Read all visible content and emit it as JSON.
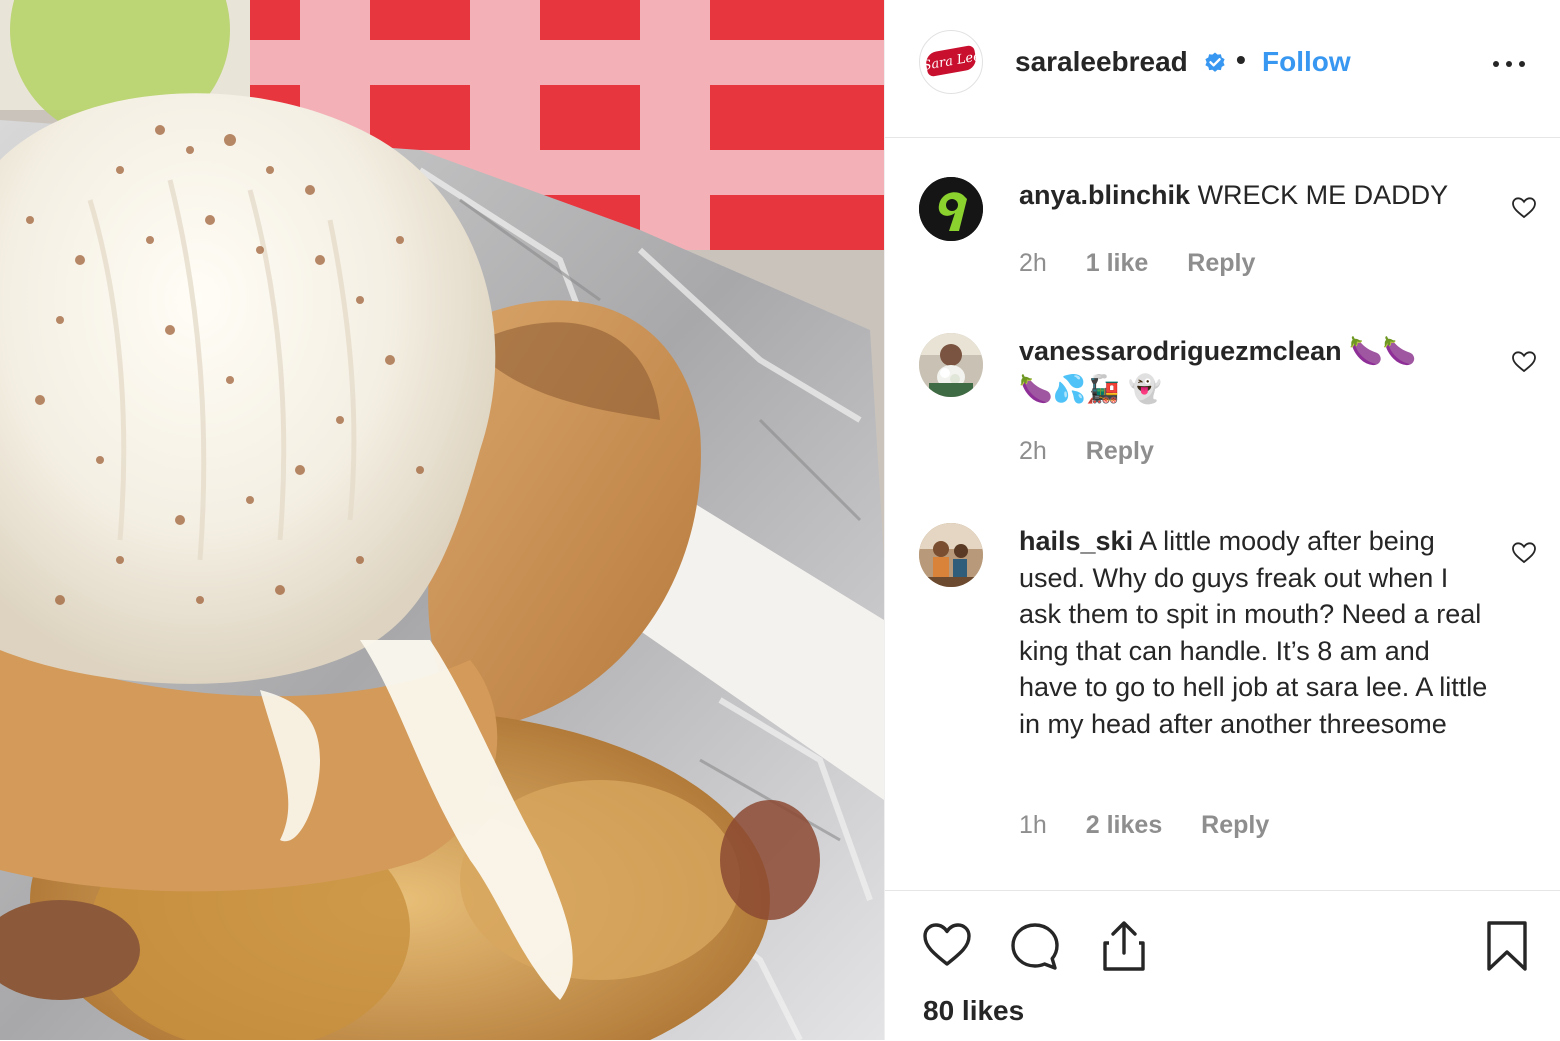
{
  "post": {
    "image_alt": "Ice cream on bread and baked apple in foil"
  },
  "header": {
    "avatar_text": "Sara Lee",
    "username": "saraleebread",
    "separator": "•",
    "follow_label": "Follow"
  },
  "comments": [
    {
      "username": "anya.blinchik",
      "text": "WRECK ME DADDY",
      "time": "2h",
      "likes": "1 like",
      "reply": "Reply"
    },
    {
      "username": "vanessarodriguezmclean",
      "text_line1": "🍆🍆",
      "text_line2": "🍆💦🚂 👻",
      "time": "2h",
      "reply": "Reply"
    },
    {
      "username": "hails_ski",
      "text": "A little moody after being used. Why do guys freak out when I ask them to spit in mouth? Need a real king that can handle. It’s 8 am and have to go to hell job at sara lee. A little in my head after another threesome",
      "time": "1h",
      "likes": "2 likes",
      "reply": "Reply"
    }
  ],
  "footer": {
    "likes_count": "80 likes"
  },
  "colors": {
    "accent": "#3897f0",
    "brand": "#c8102e",
    "muted": "#8e8e8e"
  }
}
